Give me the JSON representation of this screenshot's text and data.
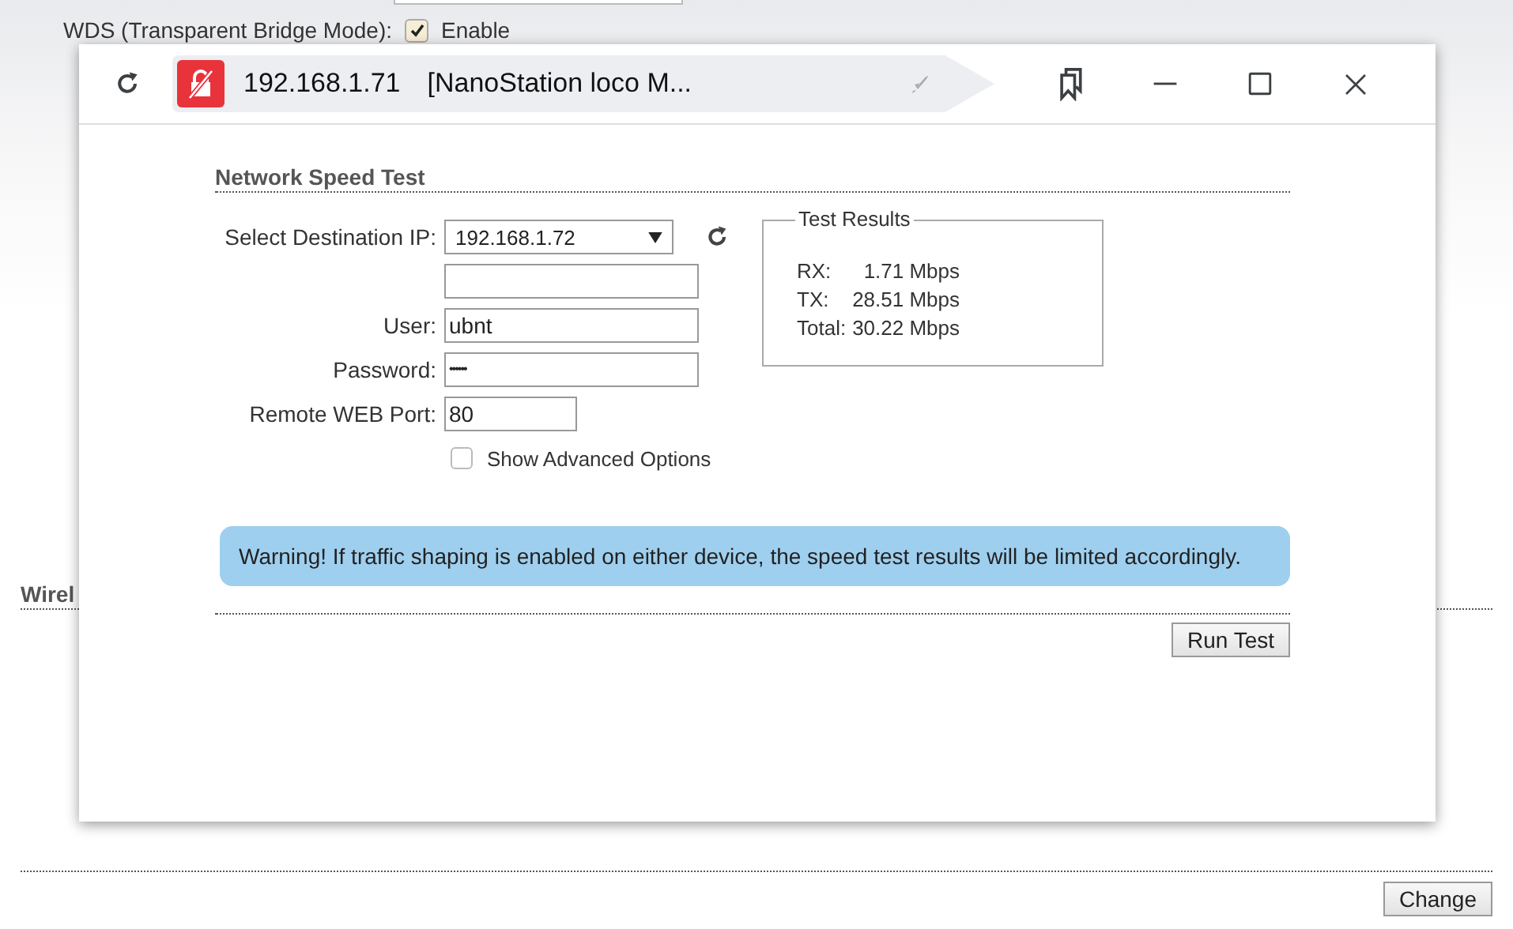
{
  "page": {
    "wds_label": "WDS (Transparent Bridge Mode):",
    "wds_enable": {
      "label": "Enable",
      "checked": true
    },
    "section_heading": "Wirel",
    "change_button": "Change"
  },
  "popup": {
    "address": "192.168.1.71",
    "title": "[NanoStation loco M...",
    "heading": "Network Speed Test",
    "destination": {
      "label": "Select Destination IP:",
      "value": "192.168.1.72"
    },
    "user": {
      "label": "User:",
      "value": "ubnt"
    },
    "password": {
      "label": "Password:",
      "value": "••••••"
    },
    "port": {
      "label": "Remote WEB Port:",
      "value": "80"
    },
    "advanced": {
      "label": "Show Advanced Options",
      "checked": false
    },
    "results": {
      "title": "Test Results",
      "rows": [
        {
          "label": "RX:",
          "value": "1.71 Mbps"
        },
        {
          "label": "TX:",
          "value": "28.51 Mbps"
        },
        {
          "label": "Total:",
          "value": "30.22 Mbps"
        }
      ]
    },
    "warning": "Warning! If traffic shaping is enabled on either device, the speed test results will be limited accordingly.",
    "run_button": "Run Test"
  }
}
